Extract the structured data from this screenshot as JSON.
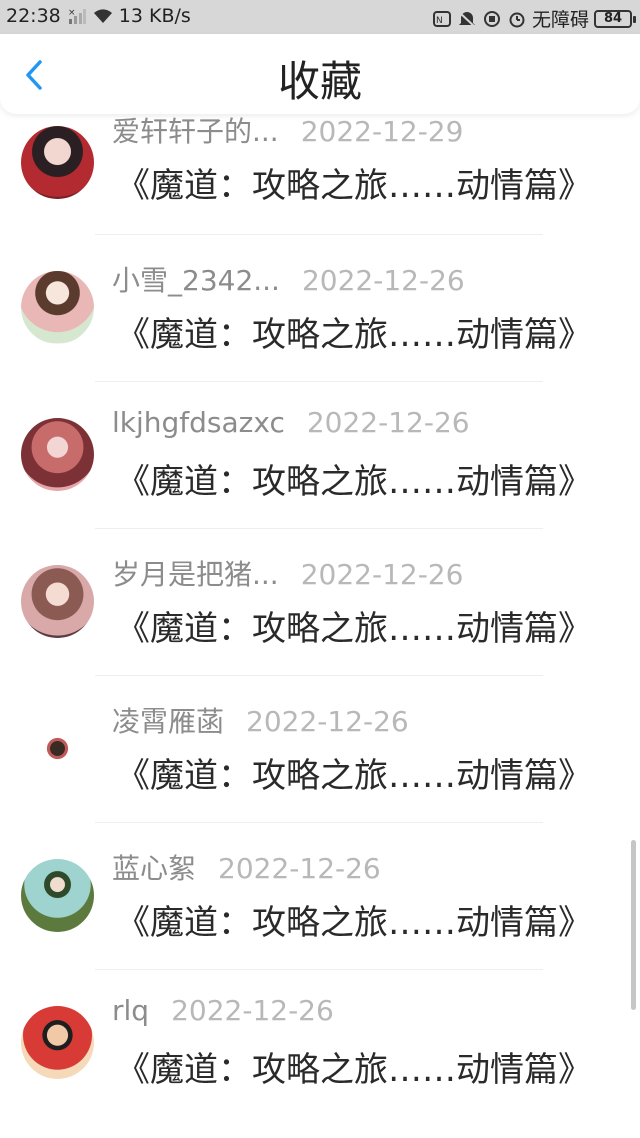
{
  "status_bar": {
    "time": "22:38",
    "network_speed": "13 KB/s",
    "carrier": "无障碍",
    "battery": "84",
    "icons": [
      "no-signal-icon",
      "wifi-icon",
      "nfc-icon",
      "mute-icon",
      "data-saver-icon",
      "alarm-icon",
      "battery-icon"
    ]
  },
  "header": {
    "title": "收藏",
    "back_icon": "chevron-left-icon",
    "accent": "#2196f3"
  },
  "items": [
    {
      "username": "爱轩轩子的...",
      "date": "2022-12-29",
      "title": "《魔道：攻略之旅……动情篇》",
      "avatar_icon": "avatar-icon"
    },
    {
      "username": "小雪_2342...",
      "date": "2022-12-26",
      "title": "《魔道：攻略之旅……动情篇》",
      "avatar_icon": "avatar-icon"
    },
    {
      "username": "lkjhgfdsazxc",
      "date": "2022-12-26",
      "title": "《魔道：攻略之旅……动情篇》",
      "avatar_icon": "avatar-icon"
    },
    {
      "username": "岁月是把猪...",
      "date": "2022-12-26",
      "title": "《魔道：攻略之旅……动情篇》",
      "avatar_icon": "avatar-icon"
    },
    {
      "username": "凌霄雁菡",
      "date": "2022-12-26",
      "title": "《魔道：攻略之旅……动情篇》",
      "avatar_icon": "avatar-icon"
    },
    {
      "username": "蓝心絮",
      "date": "2022-12-26",
      "title": "《魔道：攻略之旅……动情篇》",
      "avatar_icon": "avatar-icon"
    },
    {
      "username": "rlq",
      "date": "2022-12-26",
      "title": "《魔道：攻略之旅……动情篇》",
      "avatar_icon": "avatar-icon"
    }
  ]
}
